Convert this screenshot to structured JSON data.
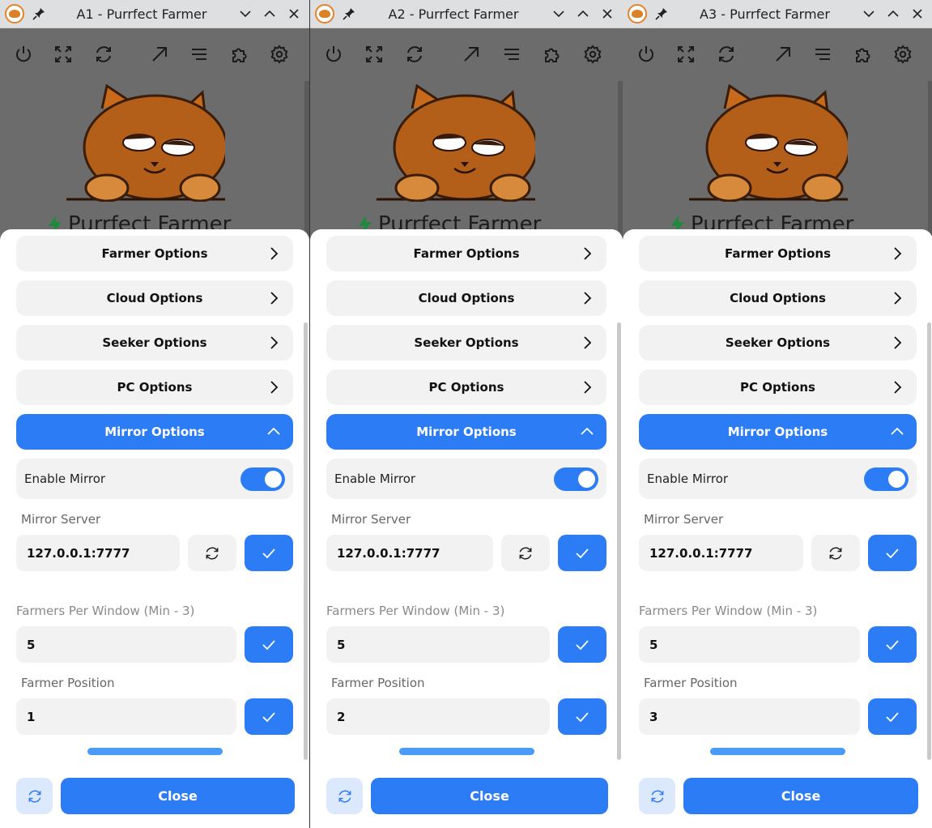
{
  "windows": [
    {
      "title": "A1 - Purrfect Farmer",
      "farmers_per_window": "5",
      "farmer_position": "1"
    },
    {
      "title": "A2 - Purrfect Farmer",
      "farmers_per_window": "5",
      "farmer_position": "2"
    },
    {
      "title": "A3 - Purrfect Farmer",
      "farmers_per_window": "5",
      "farmer_position": "3"
    }
  ],
  "common": {
    "brand": "Purrfect Farmer",
    "sections": [
      "Farmer Options",
      "Cloud Options",
      "Seeker Options",
      "PC Options"
    ],
    "open_section": "Mirror Options",
    "enable_mirror_label": "Enable Mirror",
    "enable_mirror_on": true,
    "mirror_server_label": "Mirror Server",
    "mirror_server_value": "127.0.0.1:7777",
    "farmers_per_window_label": "Farmers Per Window (Min - 3)",
    "farmer_position_label": "Farmer Position",
    "close_label": "Close"
  },
  "colors": {
    "accent": "#2c7cf6",
    "progress": "#4a9af7",
    "input_bg": "#f2f2f3"
  },
  "icons": {
    "titlebar": [
      "app-logo-icon",
      "pin-icon",
      "minimize-icon",
      "maximize-icon",
      "close-icon"
    ],
    "toolbar": [
      "power-icon",
      "fullscreen-icon",
      "reload-icon",
      "open-external-icon",
      "menu-icon",
      "extension-icon",
      "settings-icon"
    ]
  }
}
